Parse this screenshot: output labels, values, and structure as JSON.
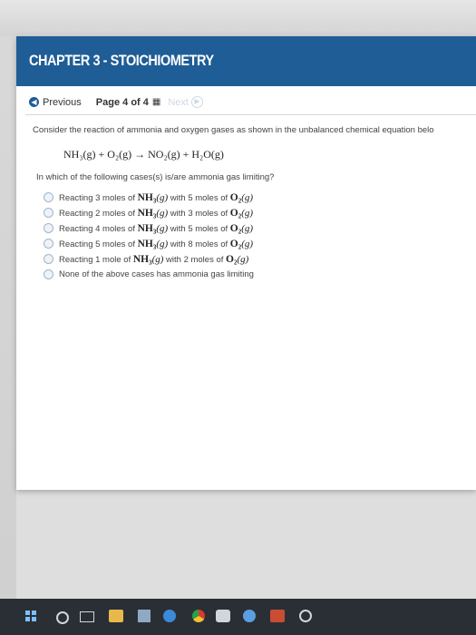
{
  "header": {
    "title": "CHAPTER 3 - STOICHIOMETRY"
  },
  "nav": {
    "previous_label": "Previous",
    "page_label": "Page 4 of 4",
    "next_label": "Next"
  },
  "question": {
    "intro": "Consider the reaction of ammonia and oxygen gases as shown in the unbalanced chemical equation belo",
    "equation": "NH₃(g) + O₂(g) → NO₂(g) + H₂O(g)",
    "prompt": "In which of the following cases(s) is/are ammonia gas limiting?",
    "options": [
      {
        "pre": "Reacting 3 moles of ",
        "chem1": "NH₃",
        "ph1": "(g)",
        "mid": " with 5 moles of ",
        "chem2": "O₂",
        "ph2": "(g)"
      },
      {
        "pre": "Reacting 2 moles of ",
        "chem1": "NH₃",
        "ph1": "(g)",
        "mid": " with 3 moles of ",
        "chem2": "O₂",
        "ph2": "(g)"
      },
      {
        "pre": "Reacting 4 moles of ",
        "chem1": "NH₃",
        "ph1": "(g)",
        "mid": " with 5 moles of ",
        "chem2": "O₂",
        "ph2": "(g)"
      },
      {
        "pre": "Reacting 5 moles of ",
        "chem1": "NH₃",
        "ph1": "(g)",
        "mid": " with 8 moles of ",
        "chem2": "O₂",
        "ph2": "(g)"
      },
      {
        "pre": "Reacting 1 mole of ",
        "chem1": "NH₃",
        "ph1": "(g)",
        "mid": " with 2 moles of ",
        "chem2": "O₂",
        "ph2": "(g)"
      }
    ],
    "none_option": "None of the above cases has ammonia gas limiting"
  },
  "colors": {
    "header_bg": "#1f5d96",
    "radio_border": "#9fb6cc"
  },
  "taskbar": {
    "icons": [
      "windows-start-icon",
      "search-icon",
      "task-view-icon",
      "file-explorer-icon",
      "store-icon",
      "edge-icon",
      "chrome-icon",
      "app-icon",
      "app-icon",
      "app-icon",
      "app-icon"
    ]
  }
}
